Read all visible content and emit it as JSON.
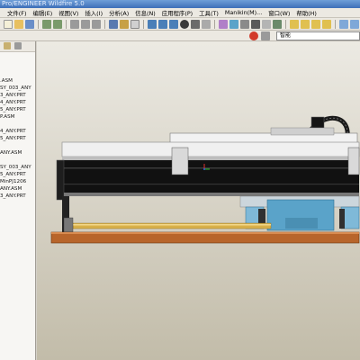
{
  "window": {
    "title": "Pro/ENGINEER Wildfire 5.0"
  },
  "menu": [
    {
      "label": "文件(F)"
    },
    {
      "label": "编辑(E)"
    },
    {
      "label": "视图(V)"
    },
    {
      "label": "插入(I)"
    },
    {
      "label": "分析(A)"
    },
    {
      "label": "信息(N)"
    },
    {
      "label": "应用程序(P)"
    },
    {
      "label": "工具(T)"
    },
    {
      "label": "Manikin(M)..."
    },
    {
      "label": "窗口(W)"
    },
    {
      "label": "帮助(H)"
    }
  ],
  "search": {
    "value": "智能"
  },
  "model_tree": {
    "items": [
      {
        "label": ".ASM"
      },
      {
        "label": "SY_003_ANY"
      },
      {
        "label": "3_ANY.PRT"
      },
      {
        "label": "4_ANY.PRT"
      },
      {
        "label": "5_ANY.PRT"
      },
      {
        "label": "P.ASM"
      },
      {
        "label": ""
      },
      {
        "label": "4_ANY.PRT"
      },
      {
        "label": "5_ANY.PRT"
      },
      {
        "label": ""
      },
      {
        "label": "ANY.ASM"
      },
      {
        "label": ""
      },
      {
        "label": "SY_003_ANY"
      },
      {
        "label": "5_ANY.PRT"
      },
      {
        "label": "MinPJ1206"
      },
      {
        "label": "ANY.ASM"
      },
      {
        "label": "3_ANY.PRT"
      }
    ]
  },
  "colors": {
    "titlebar": "#3d6fb8",
    "background_top": "#eceae3",
    "background_bottom": "#c2bca9",
    "beam_black": "#111111",
    "rail_blue": "#5aa3c9",
    "base_wood": "#b8652b",
    "rod_brass": "#d8b04a"
  }
}
